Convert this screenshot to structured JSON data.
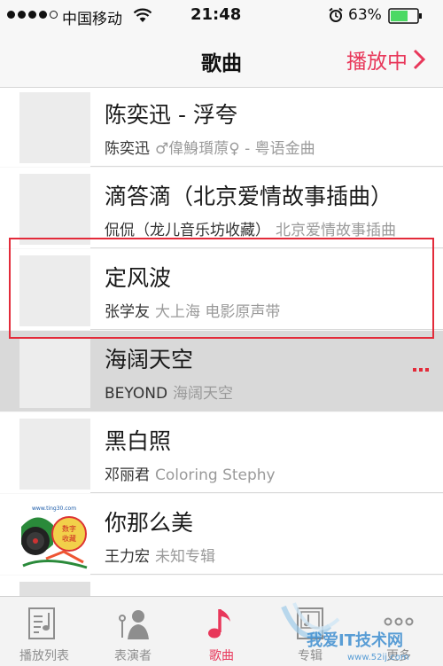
{
  "status": {
    "carrier": "中国移动",
    "time": "21:48",
    "battery": "63%"
  },
  "nav": {
    "title": "歌曲",
    "now_playing": "播放中"
  },
  "songs": [
    {
      "title": "陈奕迅 - 浮夸",
      "artist": "陈奕迅",
      "album": "♂偉鯓瓆蒝♀ - 粤语金曲"
    },
    {
      "title": "滴答滴（北京爱情故事插曲）",
      "artist": "侃侃（龙儿音乐坊收藏）",
      "album": "北京爱情故事插曲"
    },
    {
      "title": "定风波",
      "artist": "张学友",
      "album": "大上海 电影原声带"
    },
    {
      "title": "海阔天空",
      "artist": "BEYOND",
      "album": "海阔天空"
    },
    {
      "title": "黑白照",
      "artist": "邓丽君",
      "album": "Coloring Stephy"
    },
    {
      "title": "你那么美",
      "artist": "王力宏",
      "album": "未知专辑"
    }
  ],
  "cover_art": {
    "url_text": "www.ting30.com",
    "stamp_text": "数字收藏"
  },
  "tabs": [
    {
      "label": "播放列表",
      "icon": "playlist-icon"
    },
    {
      "label": "表演者",
      "icon": "artist-icon"
    },
    {
      "label": "歌曲",
      "icon": "music-note-icon",
      "active": true
    },
    {
      "label": "专辑",
      "icon": "album-icon"
    },
    {
      "label": "更多",
      "icon": "more-icon"
    }
  ],
  "watermark": {
    "text": "我爱IT技术网",
    "url": "www.52ij.com"
  },
  "colors": {
    "accent": "#e8375a",
    "highlight_border": "#e32b3a",
    "battery": "#4cd964"
  }
}
